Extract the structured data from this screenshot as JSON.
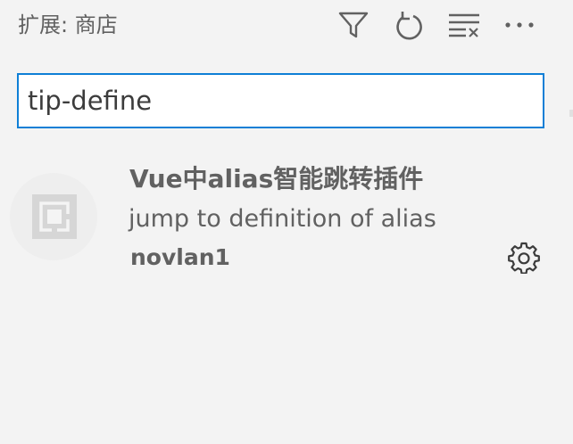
{
  "header": {
    "title": "扩展: 商店",
    "actions": [
      {
        "name": "filter",
        "icon": "filter-icon"
      },
      {
        "name": "refresh",
        "icon": "refresh-icon"
      },
      {
        "name": "clear-results",
        "icon": "clear-list-icon"
      },
      {
        "name": "more-actions",
        "icon": "ellipsis-icon"
      }
    ]
  },
  "search": {
    "value": "tip-define",
    "placeholder": ""
  },
  "extensions": [
    {
      "name": "Vue中alias智能跳转插件",
      "description": "jump to definition of alias",
      "publisher": "novlan1",
      "icon": "extension-default-icon",
      "manage_icon": "gear-icon"
    }
  ],
  "colors": {
    "background": "#f3f3f3",
    "text": "#616161",
    "focus_border": "#0e7fd6",
    "input_background": "#ffffff"
  }
}
